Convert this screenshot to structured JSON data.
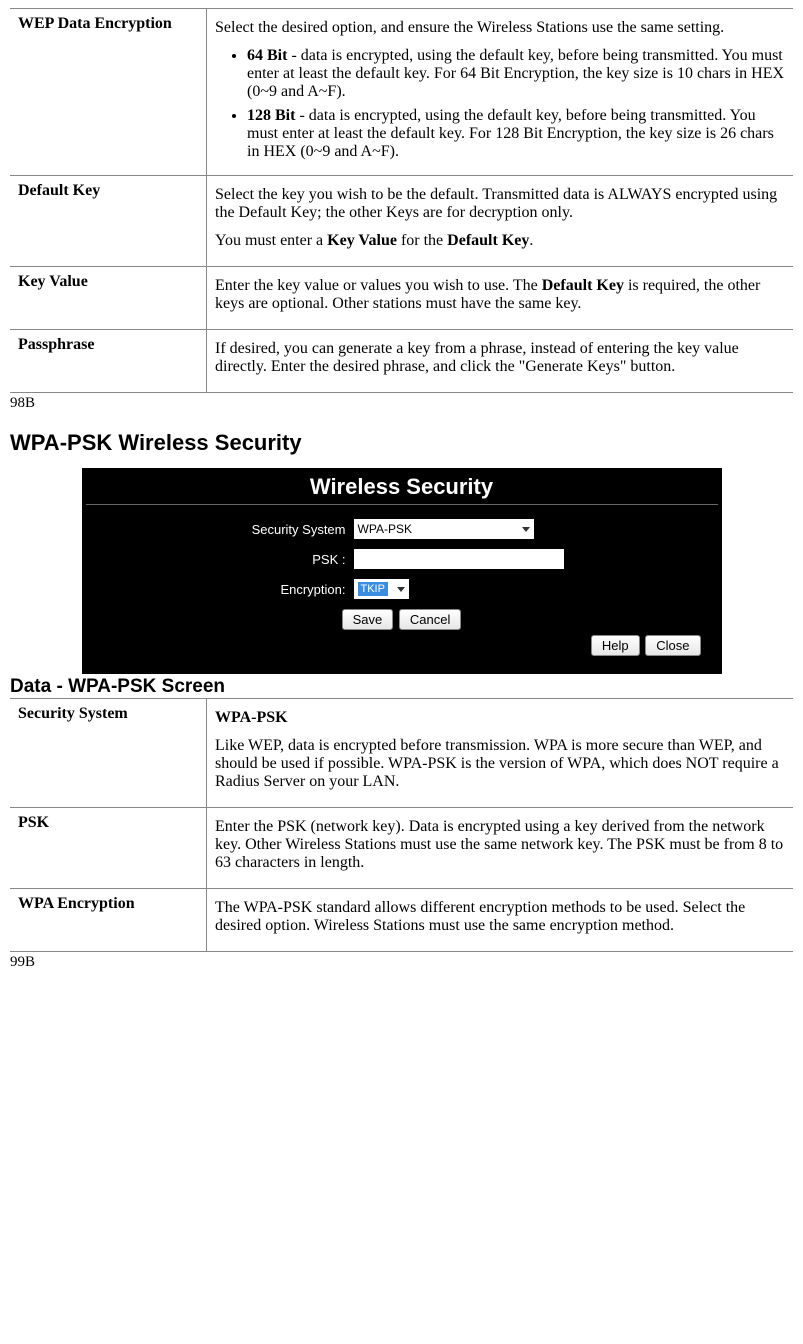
{
  "table1": {
    "row1": {
      "k": "WEP Data Encryption",
      "intro": "Select the desired option, and ensure the Wireless Stations use the same setting.",
      "b1_bold": "64 Bit",
      "b1_text": " - data is encrypted, using the default key, before being transmitted. You must enter at least the default key. For 64 Bit Encryption, the key size is 10 chars in HEX (0~9 and A~F).",
      "b2_bold": "128 Bit",
      "b2_text": " - data is encrypted, using the default key, before being transmitted. You must enter at least the default key. For 128 Bit Encryption, the key size is 26 chars in HEX (0~9 and A~F)."
    },
    "row2": {
      "k": "Default Key",
      "p1": "Select the key you wish to be the default. Transmitted data is ALWAYS encrypted using the Default Key; the other Keys are for decryption only.",
      "p2_a": "You must enter a ",
      "p2_b": "Key Value",
      "p2_c": " for the ",
      "p2_d": "Default Key",
      "p2_e": "."
    },
    "row3": {
      "k": "Key Value",
      "p_a": "Enter the key value or values you wish to use. The ",
      "p_b": "Default Key",
      "p_c": " is required, the other keys are optional. Other stations must have the same key."
    },
    "row4": {
      "k": "Passphrase",
      "p": "If desired, you can generate a key from a phrase, instead of entering the key value directly. Enter the desired phrase, and click the \"Generate Keys\" button."
    }
  },
  "marker1": "98B",
  "heading1": "WPA-PSK Wireless Security",
  "fig": {
    "title": "Wireless Security",
    "lbl_sys": "Security System",
    "val_sys": "WPA-PSK",
    "lbl_psk": "PSK :",
    "lbl_enc": "Encryption:",
    "val_enc": "TKIP",
    "btn_save": "Save",
    "btn_cancel": "Cancel",
    "btn_help": "Help",
    "btn_close": "Close"
  },
  "heading2": "Data - WPA-PSK Screen",
  "table2": {
    "row1": {
      "k": "Security System",
      "title": "WPA-PSK",
      "p": "Like WEP, data is encrypted before transmission. WPA is more secure than WEP, and should be used if possible. WPA-PSK is the version of WPA, which does NOT require a Radius Server on your LAN."
    },
    "row2": {
      "k": "PSK",
      "p": "Enter the PSK (network key). Data is encrypted using a key derived from the network key. Other Wireless Stations must use the same network key. The PSK must be from 8 to 63 characters in length."
    },
    "row3": {
      "k": "WPA Encryption",
      "p": "The WPA-PSK standard allows different encryption methods to be used. Select the desired option. Wireless Stations must use the same encryption method."
    }
  },
  "marker2": "99B"
}
